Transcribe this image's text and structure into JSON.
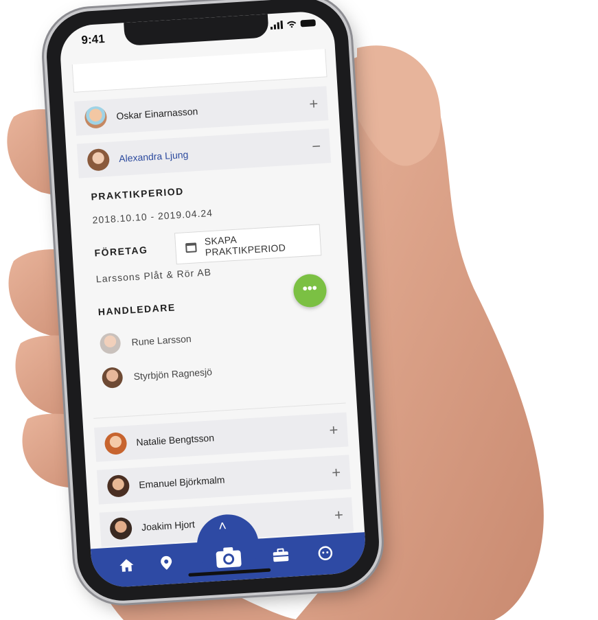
{
  "status_bar": {
    "time": "9:41"
  },
  "students": [
    {
      "name": "Oskar Einarnasson",
      "toggle": "+"
    },
    {
      "name": "Alexandra Ljung",
      "toggle": "−"
    }
  ],
  "details": {
    "period_label": "PRAKTIKPERIOD",
    "period_value": "2018.10.10 - 2019.04.24",
    "company_label": "FÖRETAG",
    "company_value": "Larssons Plåt & Rör AB",
    "supervisors_label": "HANDLEDARE",
    "supervisors": [
      "Rune Larsson",
      "Styrbjön Ragnesjö"
    ],
    "create_button_label": "SKAPA PRAKTIKPERIOD",
    "fab_label": "•••"
  },
  "more_students": [
    {
      "name": "Natalie Bengtsson",
      "toggle": "+"
    },
    {
      "name": "Emanuel Björkmalm",
      "toggle": "+"
    },
    {
      "name": "Joakim Hjort",
      "toggle": "+"
    }
  ],
  "nav": {
    "expand_glyph": "˄",
    "items": [
      "home-icon",
      "location-pin-icon",
      "camera-icon",
      "briefcase-icon",
      "face-icon"
    ]
  },
  "colors": {
    "nav_blue": "#2e4aa4",
    "active_name": "#2c4a9e",
    "fab_green": "#7bc043",
    "row_bg": "#ececef",
    "screen_bg": "#f6f6f6"
  }
}
